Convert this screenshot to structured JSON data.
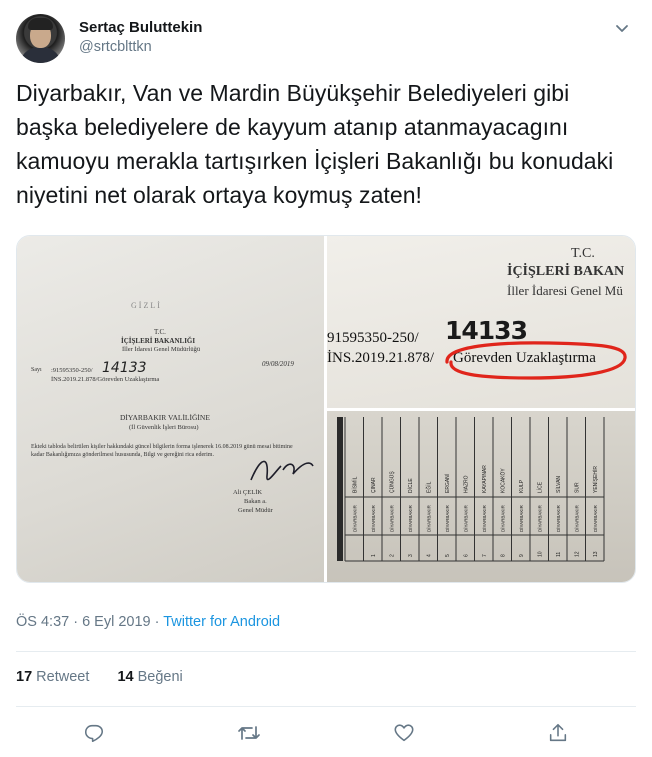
{
  "user": {
    "name": "Sertaç Buluttekin",
    "handle": "@srtcblttkn"
  },
  "tweet": {
    "text": "Diyarbakır, Van ve Mardin Büyükşehir Belediyeleri gibi başka belediyelere de kayyum atanıp atanmayacagını kamuoyu merakla tartışırken İçişleri Bakanlığı bu konudaki niyetini net olarak ortaya koymuş zaten!"
  },
  "document": {
    "gizli": "GİZLİ",
    "tc": "T.C.",
    "ministry": "İÇİŞLERİ BAKANLIĞI",
    "department": "İller İdaresi Genel Müdürlüğü",
    "sayi_label": "Sayı",
    "sayi_value": ":91595350-250/",
    "handwritten_no": "14133",
    "date": "09/08/2019",
    "ref": "İNS.2019.21.878/Görevden Uzaklaştırma",
    "recipient": "DİYARBAKIR VALİLİĞİNE",
    "recipient_sub": "(İl Güvenlik İşleri Bürosu)",
    "body": "Ekteki tabloda belirtilen kişiler hakkındaki güncel bilgilerin forma işlenerek 16.08.2019 günü mesai bitimine kadar Bakanlığımıza gönderilmesi hususunda, Bilgi ve gereğini rica ederim.",
    "signer_name": "Ali ÇELİK",
    "signer_title1": "Bakan a.",
    "signer_title2": "Genel Müdür"
  },
  "zoom": {
    "tc": "T.C.",
    "ministry": "İÇİŞLERİ BAKAN",
    "department": "İller İdaresi Genel Mü",
    "sayi": "91595350-250/",
    "handwritten_no": "14133",
    "ref_prefix": "İNS.2019.21.878/",
    "ref_highlight": "Görevden Uzaklaştırma",
    "highlight_color": "#e0251b"
  },
  "table": {
    "districts": [
      "BİSMİL",
      "ÇINAR",
      "ÇÜNGÜŞ",
      "DİCLE",
      "EĞİL",
      "ERGANİ",
      "HAZRO",
      "KAYAPINAR",
      "KOCAKÖY",
      "KULP",
      "LİCE",
      "SİLVAN",
      "SUR",
      "YENİŞEHİR"
    ],
    "province": "DİYARBAKIR",
    "row_numbers": [
      "1",
      "2",
      "3",
      "4",
      "5",
      "6",
      "7",
      "8",
      "9",
      "10",
      "11",
      "12",
      "13"
    ]
  },
  "meta": {
    "time": "ÖS 4:37 · 6 Eyl 2019 · ",
    "source": "Twitter for Android"
  },
  "stats": {
    "retweet_count": "17",
    "retweet_label": "Retweet",
    "like_count": "14",
    "like_label": "Beğeni"
  },
  "icons": {
    "more": "chevron-down-icon",
    "reply": "reply-icon",
    "retweet": "retweet-icon",
    "like": "heart-icon",
    "share": "share-icon"
  },
  "colors": {
    "link": "#1b95e0",
    "secondary_text": "#657786",
    "primary_text": "#14171a"
  }
}
